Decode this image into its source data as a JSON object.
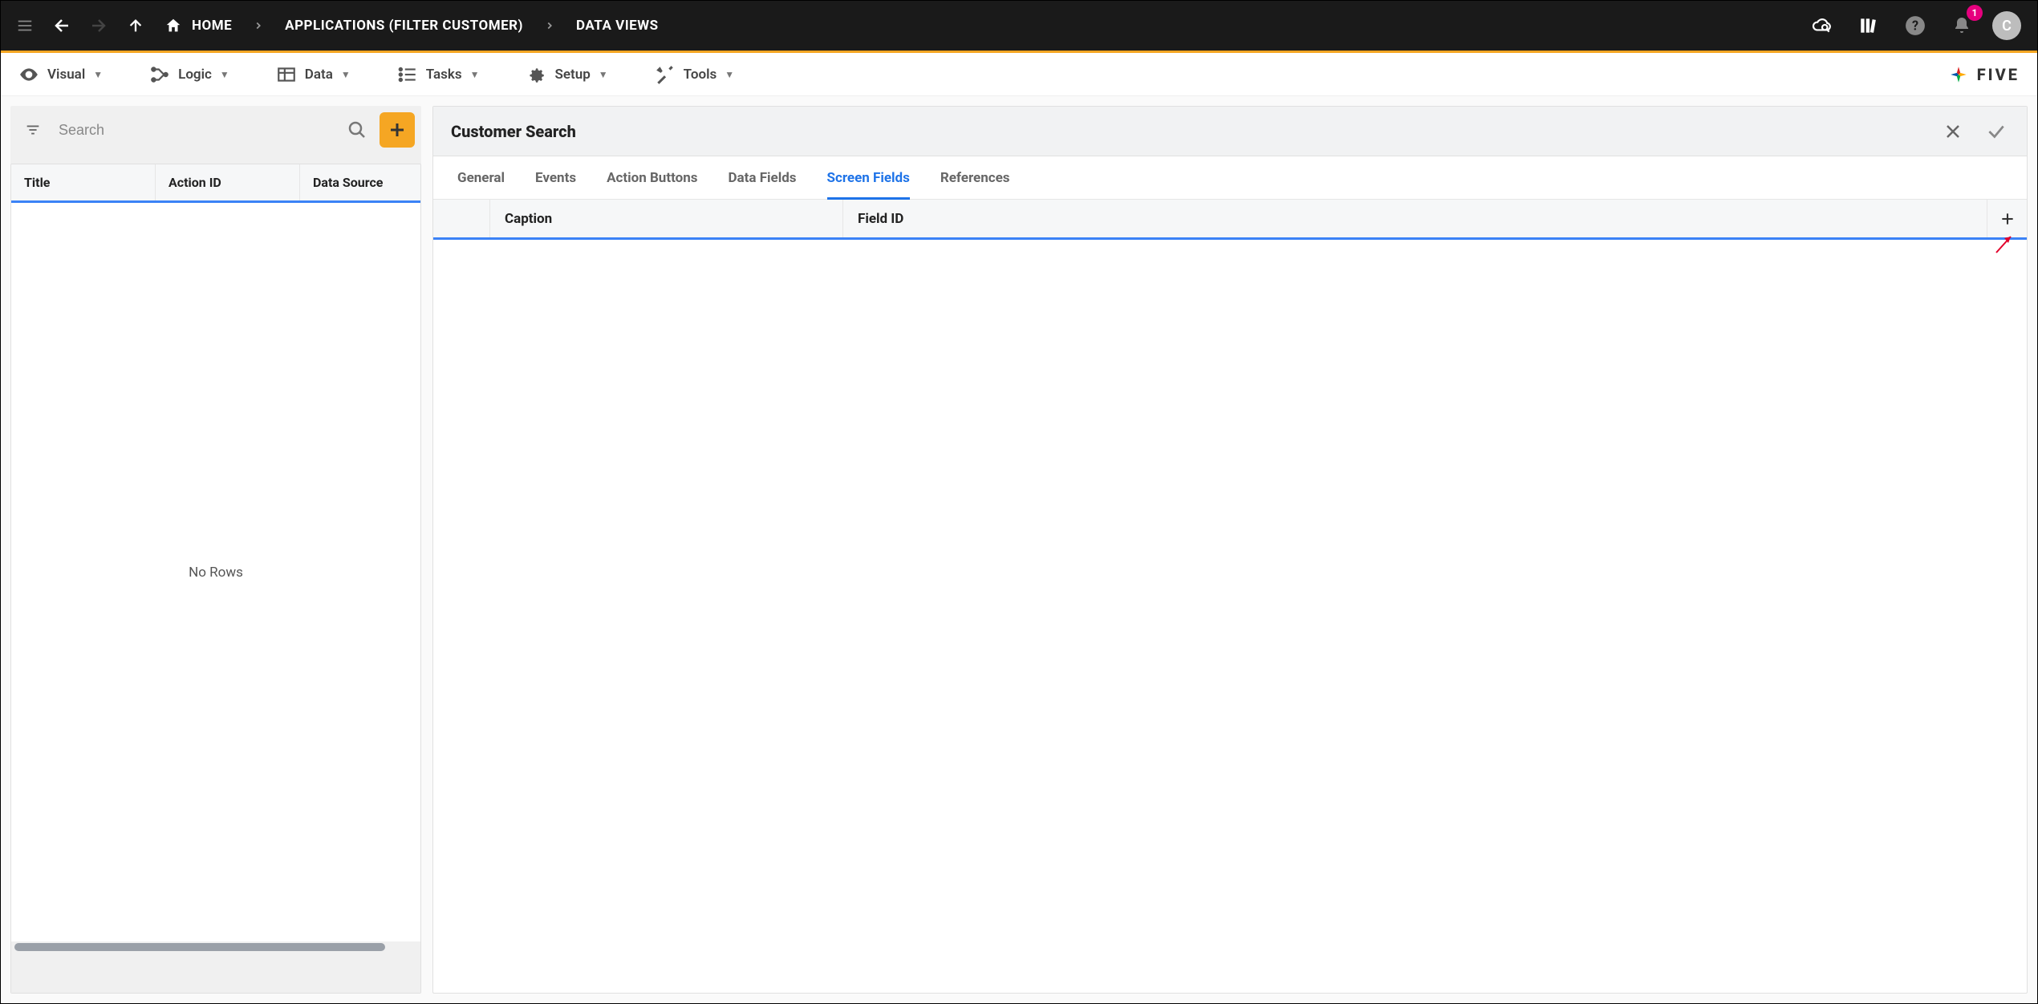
{
  "topbar": {
    "breadcrumbs": [
      {
        "label": "HOME"
      },
      {
        "label": "APPLICATIONS (FILTER CUSTOMER)"
      },
      {
        "label": "DATA VIEWS"
      }
    ],
    "notification_count": "1",
    "avatar_initial": "C"
  },
  "menubar": {
    "items": [
      {
        "label": "Visual"
      },
      {
        "label": "Logic"
      },
      {
        "label": "Data"
      },
      {
        "label": "Tasks"
      },
      {
        "label": "Setup"
      },
      {
        "label": "Tools"
      }
    ],
    "brand": "FIVE"
  },
  "left_panel": {
    "search_placeholder": "Search",
    "columns": [
      "Title",
      "Action ID",
      "Data Source"
    ],
    "empty_text": "No Rows"
  },
  "right_panel": {
    "title": "Customer Search",
    "tabs": [
      {
        "label": "General",
        "active": false
      },
      {
        "label": "Events",
        "active": false
      },
      {
        "label": "Action Buttons",
        "active": false
      },
      {
        "label": "Data Fields",
        "active": false
      },
      {
        "label": "Screen Fields",
        "active": true
      },
      {
        "label": "References",
        "active": false
      }
    ],
    "columns": [
      "Caption",
      "Field ID"
    ]
  }
}
